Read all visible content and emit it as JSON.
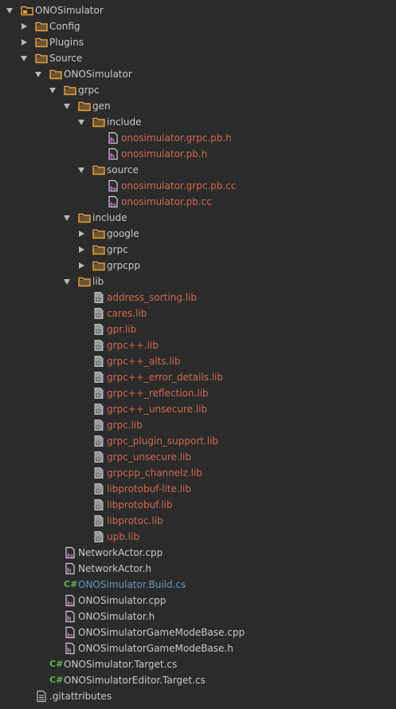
{
  "tree": [
    {
      "label": "ONOSimulator",
      "depth": 0,
      "type": "project",
      "arrow": "expanded",
      "color": "default"
    },
    {
      "label": "Config",
      "depth": 1,
      "type": "folder",
      "arrow": "collapsed",
      "color": "default"
    },
    {
      "label": "Plugins",
      "depth": 1,
      "type": "folder",
      "arrow": "collapsed",
      "color": "default"
    },
    {
      "label": "Source",
      "depth": 1,
      "type": "folder",
      "arrow": "expanded",
      "color": "default"
    },
    {
      "label": "ONOSimulator",
      "depth": 2,
      "type": "folder",
      "arrow": "expanded",
      "color": "default"
    },
    {
      "label": "grpc",
      "depth": 3,
      "type": "folder",
      "arrow": "expanded",
      "color": "default"
    },
    {
      "label": "gen",
      "depth": 4,
      "type": "folder",
      "arrow": "expanded",
      "color": "default"
    },
    {
      "label": "include",
      "depth": 5,
      "type": "folder",
      "arrow": "expanded",
      "color": "default"
    },
    {
      "label": "onosimulator.grpc.pb.h",
      "depth": 6,
      "type": "h",
      "arrow": "none",
      "color": "red"
    },
    {
      "label": "onosimulator.pb.h",
      "depth": 6,
      "type": "h",
      "arrow": "none",
      "color": "red"
    },
    {
      "label": "source",
      "depth": 5,
      "type": "folder",
      "arrow": "expanded",
      "color": "default"
    },
    {
      "label": "onosimulator.grpc.pb.cc",
      "depth": 6,
      "type": "cpp",
      "arrow": "none",
      "color": "red"
    },
    {
      "label": "onosimulator.pb.cc",
      "depth": 6,
      "type": "cpp",
      "arrow": "none",
      "color": "red"
    },
    {
      "label": "include",
      "depth": 4,
      "type": "folder",
      "arrow": "expanded",
      "color": "default"
    },
    {
      "label": "google",
      "depth": 5,
      "type": "folder",
      "arrow": "collapsed",
      "color": "default"
    },
    {
      "label": "grpc",
      "depth": 5,
      "type": "folder",
      "arrow": "collapsed",
      "color": "default"
    },
    {
      "label": "grpcpp",
      "depth": 5,
      "type": "folder",
      "arrow": "collapsed",
      "color": "default"
    },
    {
      "label": "lib",
      "depth": 4,
      "type": "folder",
      "arrow": "expanded",
      "color": "default"
    },
    {
      "label": "address_sorting.lib",
      "depth": 5,
      "type": "lib",
      "arrow": "none",
      "color": "red"
    },
    {
      "label": "cares.lib",
      "depth": 5,
      "type": "lib",
      "arrow": "none",
      "color": "red"
    },
    {
      "label": "gpr.lib",
      "depth": 5,
      "type": "lib",
      "arrow": "none",
      "color": "red"
    },
    {
      "label": "grpc++.lib",
      "depth": 5,
      "type": "lib",
      "arrow": "none",
      "color": "red"
    },
    {
      "label": "grpc++_alts.lib",
      "depth": 5,
      "type": "lib",
      "arrow": "none",
      "color": "red"
    },
    {
      "label": "grpc++_error_details.lib",
      "depth": 5,
      "type": "lib",
      "arrow": "none",
      "color": "red"
    },
    {
      "label": "grpc++_reflection.lib",
      "depth": 5,
      "type": "lib",
      "arrow": "none",
      "color": "red"
    },
    {
      "label": "grpc++_unsecure.lib",
      "depth": 5,
      "type": "lib",
      "arrow": "none",
      "color": "red"
    },
    {
      "label": "grpc.lib",
      "depth": 5,
      "type": "lib",
      "arrow": "none",
      "color": "red"
    },
    {
      "label": "grpc_plugin_support.lib",
      "depth": 5,
      "type": "lib",
      "arrow": "none",
      "color": "red"
    },
    {
      "label": "grpc_unsecure.lib",
      "depth": 5,
      "type": "lib",
      "arrow": "none",
      "color": "red"
    },
    {
      "label": "grpcpp_channelz.lib",
      "depth": 5,
      "type": "lib",
      "arrow": "none",
      "color": "red"
    },
    {
      "label": "libprotobuf-lite.lib",
      "depth": 5,
      "type": "lib",
      "arrow": "none",
      "color": "red"
    },
    {
      "label": "libprotobuf.lib",
      "depth": 5,
      "type": "lib",
      "arrow": "none",
      "color": "red"
    },
    {
      "label": "libprotoc.lib",
      "depth": 5,
      "type": "lib",
      "arrow": "none",
      "color": "red"
    },
    {
      "label": "upb.lib",
      "depth": 5,
      "type": "lib",
      "arrow": "none",
      "color": "red"
    },
    {
      "label": "NetworkActor.cpp",
      "depth": 3,
      "type": "cpp",
      "arrow": "none",
      "color": "default"
    },
    {
      "label": "NetworkActor.h",
      "depth": 3,
      "type": "h",
      "arrow": "none",
      "color": "default"
    },
    {
      "label": "ONOSimulator.Build.cs",
      "depth": 3,
      "type": "cs",
      "arrow": "none",
      "color": "blue"
    },
    {
      "label": "ONOSimulator.cpp",
      "depth": 3,
      "type": "cpp",
      "arrow": "none",
      "color": "default"
    },
    {
      "label": "ONOSimulator.h",
      "depth": 3,
      "type": "h",
      "arrow": "none",
      "color": "default"
    },
    {
      "label": "ONOSimulatorGameModeBase.cpp",
      "depth": 3,
      "type": "cpp",
      "arrow": "none",
      "color": "default"
    },
    {
      "label": "ONOSimulatorGameModeBase.h",
      "depth": 3,
      "type": "h",
      "arrow": "none",
      "color": "default"
    },
    {
      "label": "ONOSimulator.Target.cs",
      "depth": 2,
      "type": "cs",
      "arrow": "none",
      "color": "default"
    },
    {
      "label": "ONOSimulatorEditor.Target.cs",
      "depth": 2,
      "type": "cs",
      "arrow": "none",
      "color": "default"
    },
    {
      "label": ".gitattributes",
      "depth": 1,
      "type": "text",
      "arrow": "none",
      "color": "default"
    }
  ],
  "cs_icon_text": "C#",
  "colors": {
    "background": "#2b2b2b",
    "text": "#c8c8c8",
    "vcs_unversioned": "#cf6a4c",
    "vcs_modified": "#6897bb",
    "folder": "#e8a33d",
    "cs_icon": "#62b543"
  }
}
